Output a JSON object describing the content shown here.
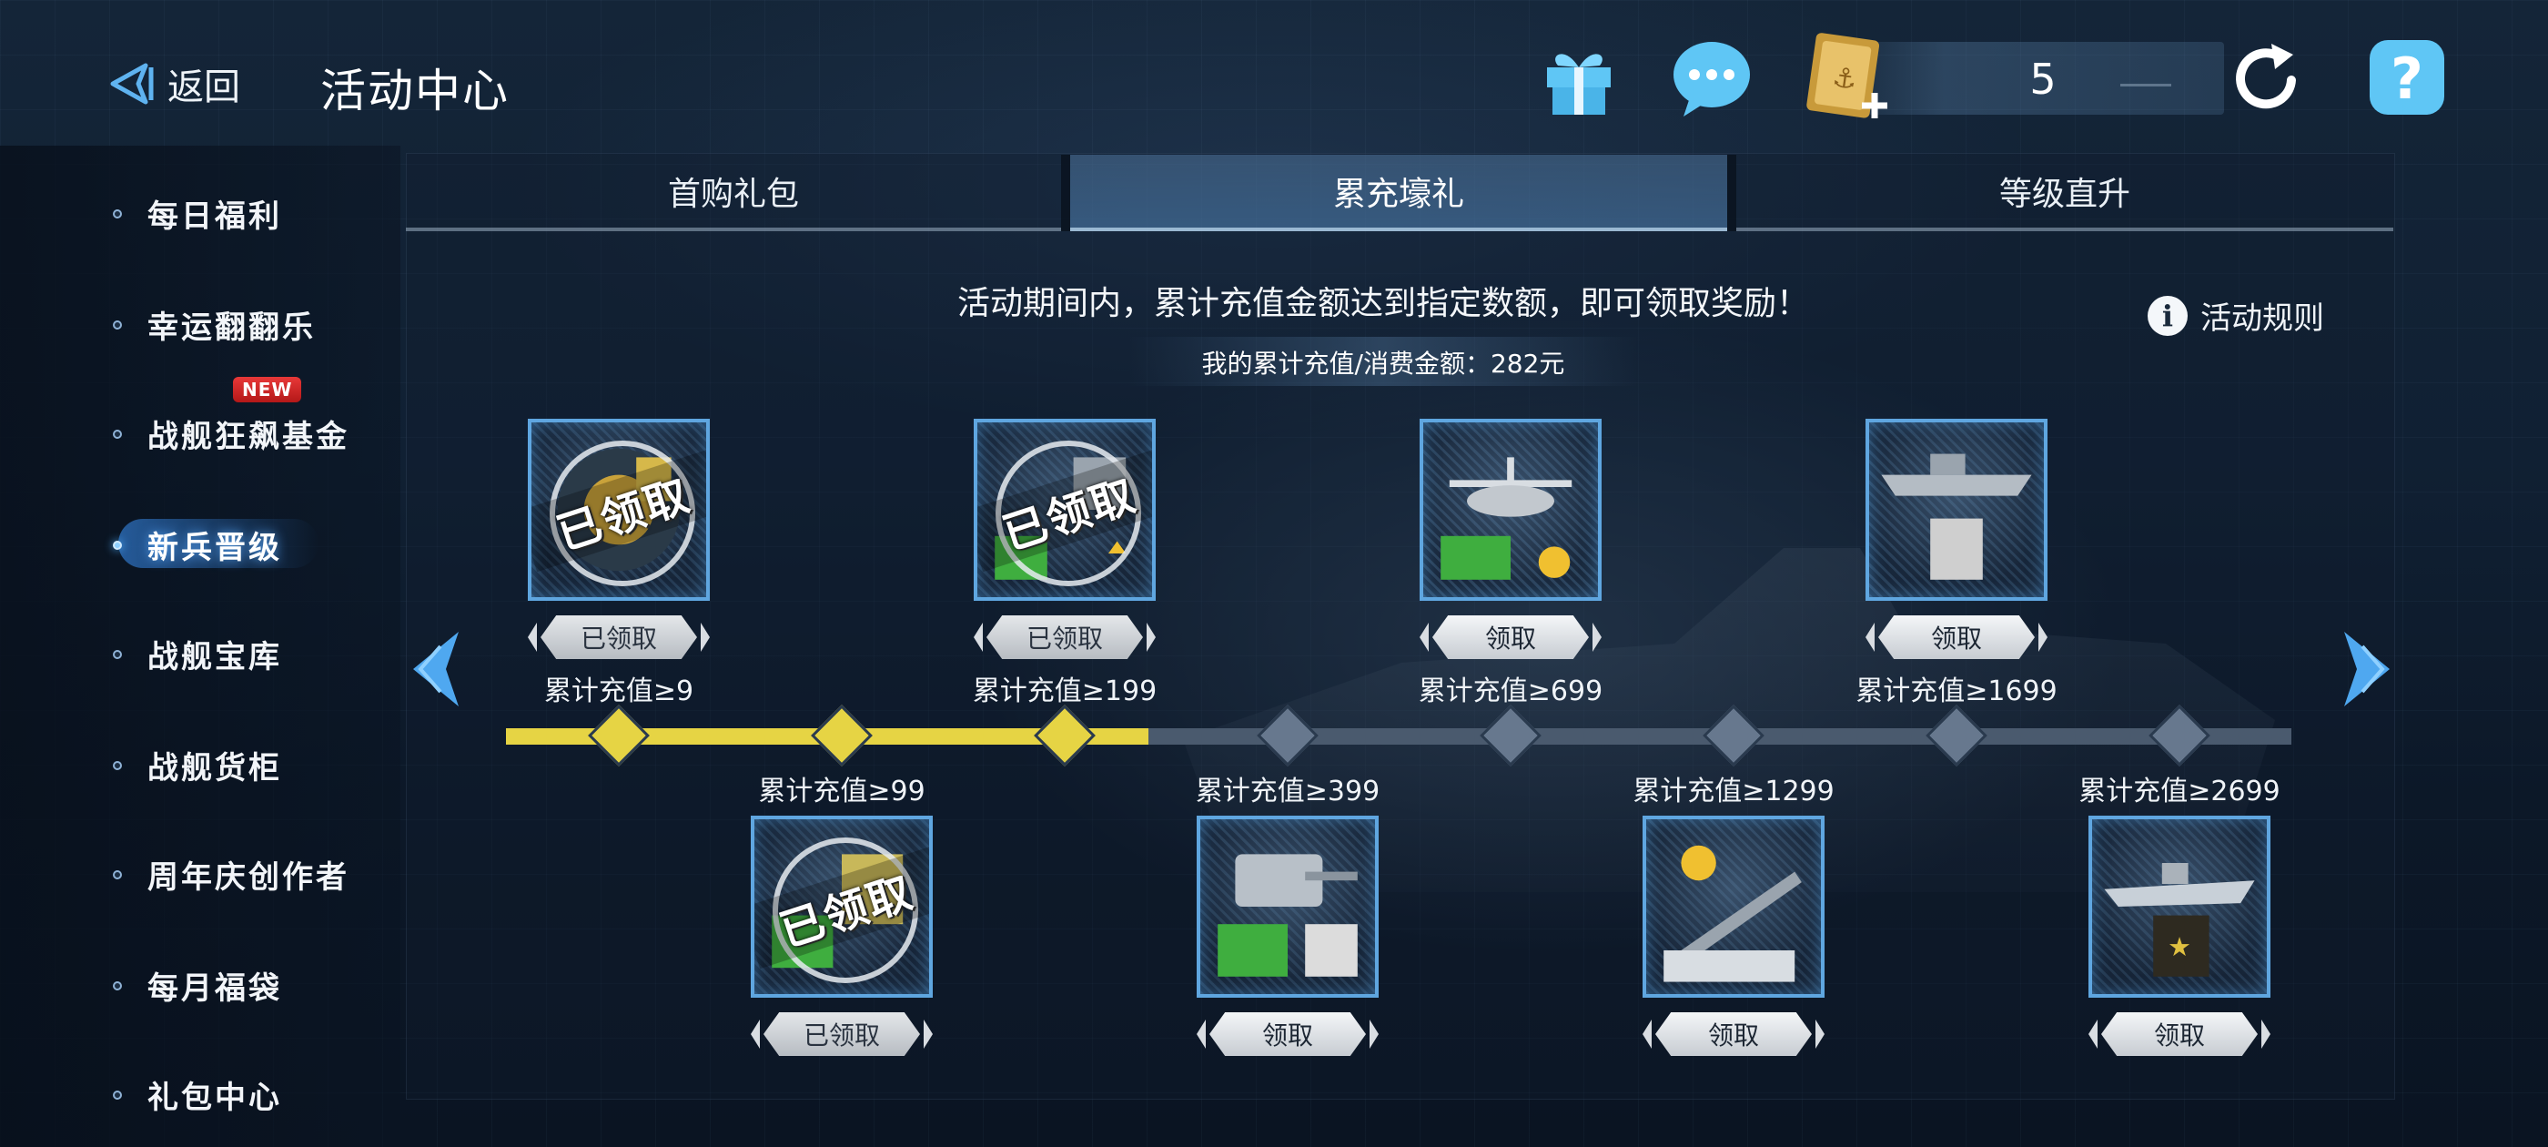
{
  "header": {
    "back_label": "返回",
    "title": "活动中心",
    "currency_value": "5",
    "icons": [
      "gift-icon",
      "chat-icon",
      "ticket-icon",
      "refresh-icon",
      "help-icon"
    ]
  },
  "sidebar": {
    "items": [
      {
        "label": "每日福利"
      },
      {
        "label": "幸运翻翻乐"
      },
      {
        "label": "战舰狂飙基金",
        "badge": "NEW"
      },
      {
        "label": "新兵晋级",
        "active": true
      },
      {
        "label": "战舰宝库"
      },
      {
        "label": "战舰货柜"
      },
      {
        "label": "周年庆创作者"
      },
      {
        "label": "每月福袋"
      },
      {
        "label": "礼包中心"
      }
    ]
  },
  "tabs": [
    {
      "label": "首购礼包"
    },
    {
      "label": "累充壕礼",
      "active": true
    },
    {
      "label": "等级直升"
    }
  ],
  "content": {
    "headline": "活动期间内，累计充值金额达到指定数额，即可领取奖励！",
    "total_spent": "我的累计充值/消费金额：282元",
    "rules_label": "活动规则",
    "stamp_text": "已领取"
  },
  "milestones": [
    {
      "label": "累计充值≥9",
      "button": "已领取",
      "claimed": true,
      "reached": true
    },
    {
      "label": "累计充值≥99",
      "button": "已领取",
      "claimed": true,
      "reached": true
    },
    {
      "label": "累计充值≥199",
      "button": "已领取",
      "claimed": true,
      "reached": true
    },
    {
      "label": "累计充值≥399",
      "button": "领取",
      "claimed": false,
      "reached": false
    },
    {
      "label": "累计充值≥699",
      "button": "领取",
      "claimed": false,
      "reached": false
    },
    {
      "label": "累计充值≥1299",
      "button": "领取",
      "claimed": false,
      "reached": false
    },
    {
      "label": "累计充值≥1699",
      "button": "领取",
      "claimed": false,
      "reached": false
    },
    {
      "label": "累计充值≥2699",
      "button": "领取",
      "claimed": false,
      "reached": false
    }
  ],
  "progress_fraction": 0.36,
  "colors": {
    "accent_blue": "#5fa6e0",
    "progress_yellow": "#e6d444",
    "track_gray": "#4a5a6e"
  }
}
